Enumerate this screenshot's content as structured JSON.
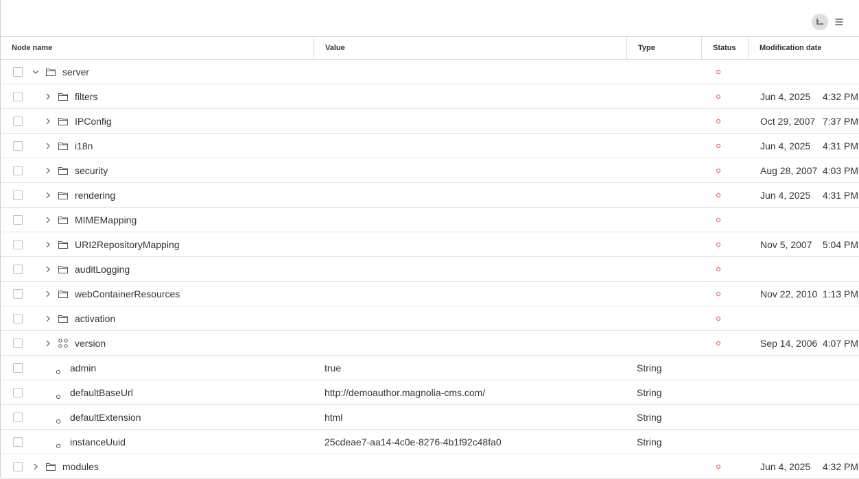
{
  "toolbar": {
    "tree_view_icon": "tree-view-icon",
    "list_view_icon": "list-view-icon"
  },
  "columns": {
    "node_name": "Node name",
    "value": "Value",
    "type": "Type",
    "status": "Status",
    "modification_date": "Modification date"
  },
  "colors": {
    "status": "#e64a3b",
    "tree_button_bg": "#dedede"
  },
  "rows": [
    {
      "name": "server",
      "kind": "folder",
      "depth": 0,
      "expanded": true,
      "value": "",
      "type": "",
      "status": true,
      "date": "",
      "time": ""
    },
    {
      "name": "filters",
      "kind": "folder",
      "depth": 1,
      "expanded": false,
      "value": "",
      "type": "",
      "status": true,
      "date": "Jun 4, 2025",
      "time": "4:32 PM"
    },
    {
      "name": "IPConfig",
      "kind": "folder",
      "depth": 1,
      "expanded": false,
      "value": "",
      "type": "",
      "status": true,
      "date": "Oct 29, 2007",
      "time": "7:37 PM"
    },
    {
      "name": "i18n",
      "kind": "folder",
      "depth": 1,
      "expanded": false,
      "value": "",
      "type": "",
      "status": true,
      "date": "Jun 4, 2025",
      "time": "4:31 PM"
    },
    {
      "name": "security",
      "kind": "folder",
      "depth": 1,
      "expanded": false,
      "value": "",
      "type": "",
      "status": true,
      "date": "Aug 28, 2007",
      "time": "4:03 PM"
    },
    {
      "name": "rendering",
      "kind": "folder",
      "depth": 1,
      "expanded": false,
      "value": "",
      "type": "",
      "status": true,
      "date": "Jun 4, 2025",
      "time": "4:31 PM"
    },
    {
      "name": "MIMEMapping",
      "kind": "folder",
      "depth": 1,
      "expanded": false,
      "value": "",
      "type": "",
      "status": true,
      "date": "",
      "time": ""
    },
    {
      "name": "URI2RepositoryMapping",
      "kind": "folder",
      "depth": 1,
      "expanded": false,
      "value": "",
      "type": "",
      "status": true,
      "date": "Nov 5, 2007",
      "time": "5:04 PM"
    },
    {
      "name": "auditLogging",
      "kind": "folder",
      "depth": 1,
      "expanded": false,
      "value": "",
      "type": "",
      "status": true,
      "date": "",
      "time": ""
    },
    {
      "name": "webContainerResources",
      "kind": "folder",
      "depth": 1,
      "expanded": false,
      "value": "",
      "type": "",
      "status": true,
      "date": "Nov 22, 2010",
      "time": "1:13 PM"
    },
    {
      "name": "activation",
      "kind": "folder",
      "depth": 1,
      "expanded": false,
      "value": "",
      "type": "",
      "status": true,
      "date": "",
      "time": ""
    },
    {
      "name": "version",
      "kind": "content",
      "depth": 1,
      "expanded": false,
      "value": "",
      "type": "",
      "status": true,
      "date": "Sep 14, 2006",
      "time": "4:07 PM"
    },
    {
      "name": "admin",
      "kind": "property",
      "depth": 1,
      "value": "true",
      "type": "String",
      "status": false,
      "date": "",
      "time": ""
    },
    {
      "name": "defaultBaseUrl",
      "kind": "property",
      "depth": 1,
      "value": "http://demoauthor.magnolia-cms.com/",
      "type": "String",
      "status": false,
      "date": "",
      "time": ""
    },
    {
      "name": "defaultExtension",
      "kind": "property",
      "depth": 1,
      "value": "html",
      "type": "String",
      "status": false,
      "date": "",
      "time": ""
    },
    {
      "name": "instanceUuid",
      "kind": "property",
      "depth": 1,
      "value": "25cdeae7-aa14-4c0e-8276-4b1f92c48fa0",
      "type": "String",
      "status": false,
      "date": "",
      "time": ""
    },
    {
      "name": "modules",
      "kind": "folder",
      "depth": 0,
      "expanded": false,
      "value": "",
      "type": "",
      "status": true,
      "date": "Jun 4, 2025",
      "time": "4:32 PM"
    }
  ]
}
